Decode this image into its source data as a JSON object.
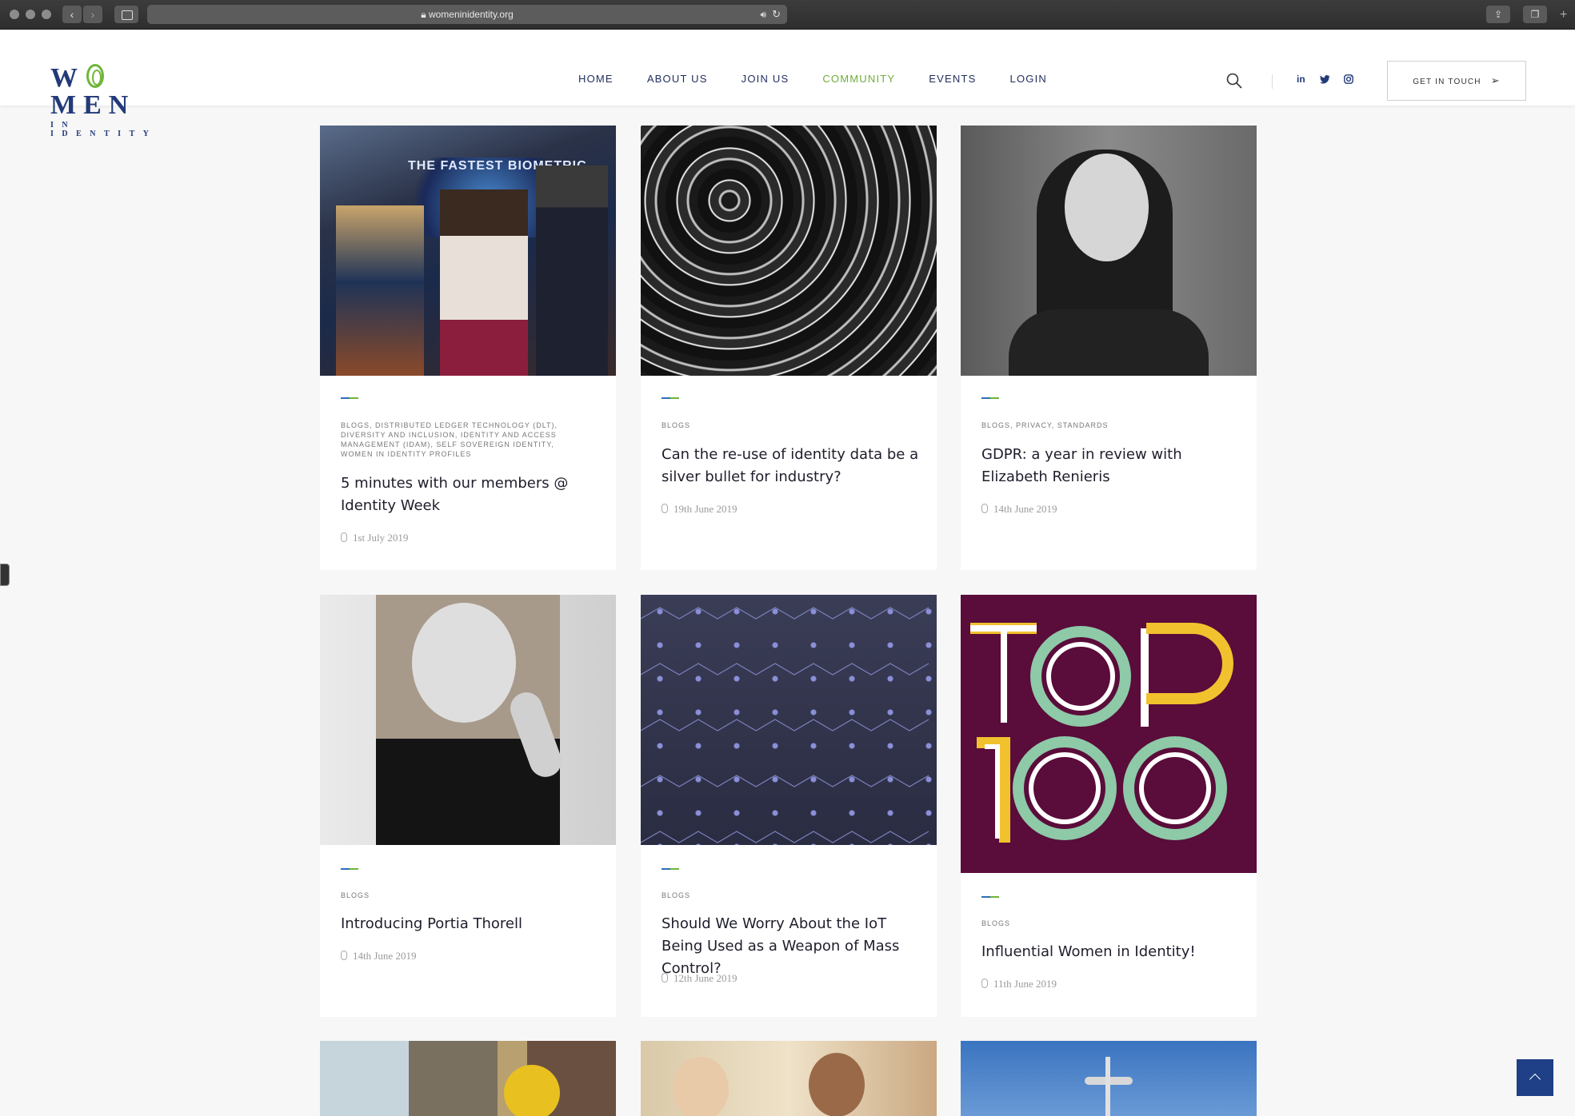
{
  "browser": {
    "url": "womeninidentity.org"
  },
  "header": {
    "logo_top": "W MEN",
    "logo_bottom": "IN IDENTITY",
    "nav": [
      {
        "label": "HOME",
        "active": false
      },
      {
        "label": "ABOUT US",
        "active": false
      },
      {
        "label": "JOIN US",
        "active": false
      },
      {
        "label": "COMMUNITY",
        "active": true
      },
      {
        "label": "EVENTS",
        "active": false
      },
      {
        "label": "LOGIN",
        "active": false
      }
    ],
    "social": [
      "in",
      "twitter-icon",
      "instagram-icon"
    ],
    "cta_label": "GET IN TOUCH"
  },
  "posts": [
    {
      "categories": "BLOGS, DISTRIBUTED LEDGER TECHNOLOGY (DLT), DIVERSITY AND INCLUSION, IDENTITY AND ACCESS MANAGEMENT (IDAM), SELF SOVEREIGN IDENTITY, WOMEN IN IDENTITY PROFILES",
      "title": "5 minutes with our members @ Identity Week",
      "date": "1st July 2019"
    },
    {
      "categories": "BLOGS",
      "title": "Can the re-use of identity data be a silver bullet for industry?",
      "date": "19th June 2019"
    },
    {
      "categories": "BLOGS, PRIVACY, STANDARDS",
      "title": "GDPR: a year in review with Elizabeth Renieris",
      "date": "14th June 2019"
    },
    {
      "categories": "BLOGS",
      "title": "Introducing Portia Thorell",
      "date": "14th June 2019"
    },
    {
      "categories": "BLOGS",
      "title": "Should We Worry About the IoT Being Used as a Weapon of Mass Control?",
      "date": "12th June 2019"
    },
    {
      "categories": "BLOGS",
      "title": "Influential Women in Identity!",
      "date": "11th June 2019"
    }
  ],
  "colors": {
    "brand_navy": "#233a7a",
    "brand_green": "#6fb53a",
    "top100_bg": "#5a0c3a"
  }
}
